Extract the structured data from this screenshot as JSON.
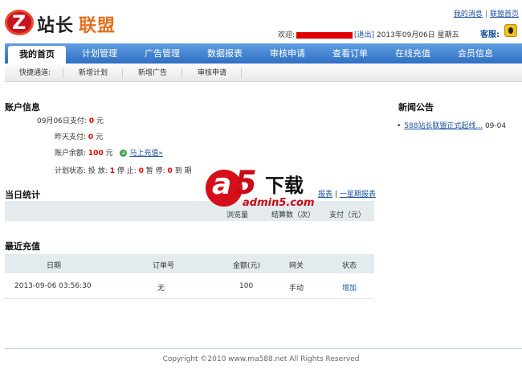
{
  "header": {
    "logo_text_1": "站长",
    "logo_text_2": "联盟",
    "logo_letter": "Z",
    "top_links": [
      "我的消息",
      "联盟首页"
    ],
    "top_links_sep": "|",
    "welcome_label": "欢迎:",
    "logout": "[退出]",
    "date": "2013年09月06日 星期五",
    "kefu": "客服:"
  },
  "nav": {
    "tabs": [
      "我的首页",
      "计划管理",
      "广告管理",
      "数据报表",
      "审核申请",
      "查看订单",
      "在线充值",
      "会员信息"
    ]
  },
  "quick": {
    "label": "快捷通道:",
    "links": [
      "新增计划",
      "新增广告",
      "审核申请"
    ]
  },
  "account": {
    "title": "账户信息",
    "today_label": "09月06日支付:",
    "today_value": "0",
    "yesterday_label": "昨天支付:",
    "yesterday_value": "0",
    "balance_label": "账户余额:",
    "balance_value": "100",
    "unit": "元",
    "recharge_link": "马上充值»",
    "plan_label": "计划状态:",
    "plan_parts": [
      "投 放:",
      "1",
      "停 止:",
      "0",
      "暂 停:",
      "0",
      "到 期"
    ]
  },
  "news": {
    "title": "新闻公告",
    "items": [
      {
        "text": "588站长联盟正式起线...",
        "date": "09-04"
      }
    ]
  },
  "stats": {
    "title": "当日统计",
    "links": [
      "报表",
      "一星期报表"
    ],
    "links_sep": "|",
    "headers": [
      "浏览量",
      "结算数（次）",
      "支付（元）"
    ]
  },
  "recharge": {
    "title": "最近充值",
    "headers": [
      "日期",
      "订单号",
      "金额(元)",
      "网关",
      "状态"
    ],
    "rows": [
      {
        "date": "2013-09-06 03:56:30",
        "order": "无",
        "amount": "100",
        "gateway": "手动",
        "status": "增加"
      }
    ]
  },
  "watermark": {
    "a": "a",
    "five": "5",
    "xz": "下载",
    "url": "admin5.com"
  },
  "footer": {
    "text": "Copyright ©2010 www.ma588.net All Rights Reserved"
  },
  "colors": {
    "nav_blue": "#2f6fc4",
    "red": "#e00000",
    "link": "#1a4f9c",
    "accent_orange": "#e4701e"
  }
}
